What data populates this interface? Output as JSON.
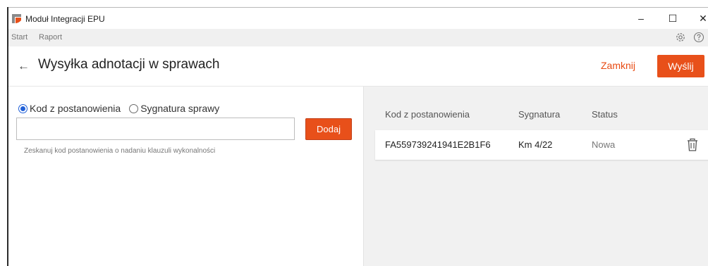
{
  "window": {
    "title": "Moduł Integracji EPU",
    "controls": {
      "minimize": "–",
      "maximize": "☐",
      "close": "✕"
    },
    "accent": "#e8501a"
  },
  "menu": {
    "items": [
      "Start",
      "Raport"
    ],
    "icons": [
      "gear-icon",
      "help-icon"
    ]
  },
  "header": {
    "back_icon": "←",
    "title": "Wysyłka adnotacji w sprawach",
    "close_label": "Zamknij",
    "send_label": "Wyślij"
  },
  "form": {
    "radio_options": [
      {
        "label": "Kod z postanowienia",
        "selected": true
      },
      {
        "label": "Sygnatura sprawy",
        "selected": false
      }
    ],
    "input_value": "",
    "input_placeholder": "",
    "add_label": "Dodaj",
    "helper": "Zeskanuj kod postanowienia o nadaniu klauzuli wykonalności"
  },
  "table": {
    "headers": [
      "Kod z postanowienia",
      "Sygnatura",
      "Status"
    ],
    "rows": [
      {
        "code": "FA559739241941E2B1F6",
        "signature": "Km 4/22",
        "status": "Nowa"
      }
    ]
  }
}
